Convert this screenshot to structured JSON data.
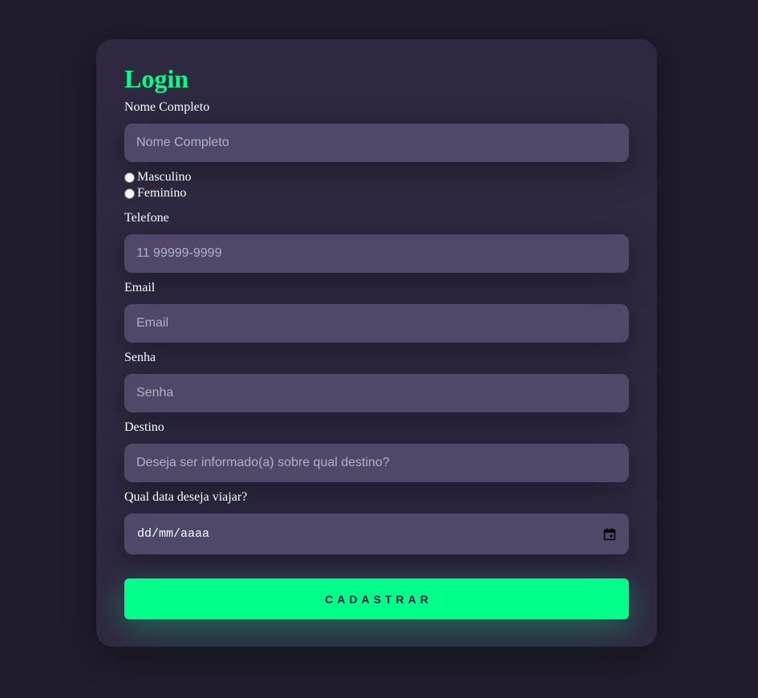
{
  "form": {
    "title": "Login",
    "full_name": {
      "label": "Nome Completo",
      "placeholder": "Nome Completo"
    },
    "gender": {
      "options": [
        "Masculino",
        "Feminino"
      ]
    },
    "phone": {
      "label": "Telefone",
      "placeholder": "11 99999-9999"
    },
    "email": {
      "label": "Email",
      "placeholder": "Email"
    },
    "password": {
      "label": "Senha",
      "placeholder": "Senha"
    },
    "destination": {
      "label": "Destino",
      "placeholder": "Deseja ser informado(a) sobre qual destino?"
    },
    "travel_date": {
      "label": "Qual data deseja viajar?",
      "placeholder": "dd/mm/aaaa",
      "icon": "calendar-icon"
    },
    "submit_label": "Cadastrar"
  },
  "colors": {
    "page_background": "#201b2d",
    "card_background": "#2f2841",
    "input_background": "#514869",
    "accent": "#00ff88",
    "button_text": "#2b134b"
  }
}
